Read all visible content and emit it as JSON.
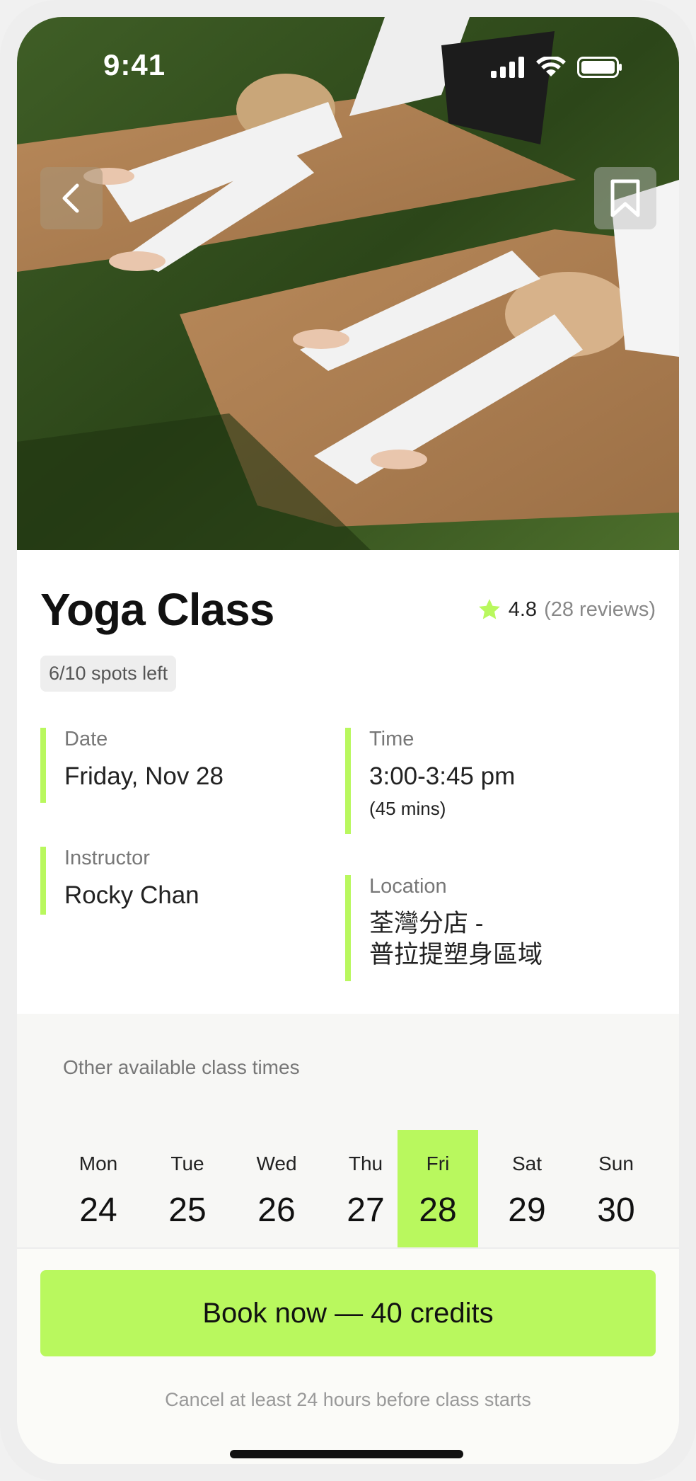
{
  "status_bar": {
    "time": "9:41"
  },
  "hero": {
    "image_description_icon": "yoga-photo"
  },
  "class": {
    "title": "Yoga Class",
    "rating_value": "4.8",
    "rating_reviews": "(28 reviews)",
    "spots": "6/10 spots left"
  },
  "details": {
    "date_label": "Date",
    "date_value": "Friday, Nov 28",
    "time_label": "Time",
    "time_value": "3:00-3:45 pm",
    "time_sub": "(45 mins)",
    "instructor_label": "Instructor",
    "instructor_value": "Rocky Chan",
    "location_label": "Location",
    "location_line1": "荃灣分店 -",
    "location_line2": "普拉提塑身區域"
  },
  "other_times": {
    "title": "Other available class times",
    "days": [
      {
        "name": "Mon",
        "num": "24"
      },
      {
        "name": "Tue",
        "num": "25"
      },
      {
        "name": "Wed",
        "num": "26"
      },
      {
        "name": "Thu",
        "num": "27"
      },
      {
        "name": "Fri",
        "num": "28"
      },
      {
        "name": "Sat",
        "num": "29"
      },
      {
        "name": "Sun",
        "num": "30"
      }
    ],
    "selected": "Fri"
  },
  "booking": {
    "button_label": "Book now — 40 credits",
    "note": "Cancel at least 24 hours before class starts"
  },
  "colors": {
    "accent": "#b9f85e"
  },
  "icons": [
    "back-arrow-icon",
    "bookmark-icon",
    "star-icon",
    "signal-icon",
    "wifi-icon",
    "battery-icon"
  ]
}
